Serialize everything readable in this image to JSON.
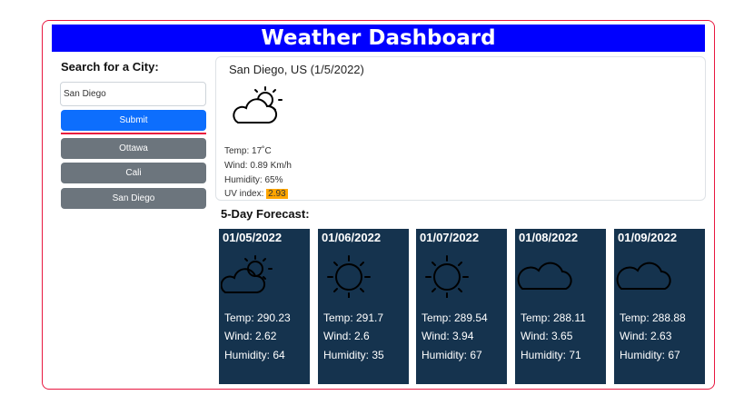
{
  "header": {
    "title": "Weather Dashboard"
  },
  "sidebar": {
    "search_title": "Search for a City:",
    "search_value": "San Diego",
    "submit_label": "Submit",
    "history": [
      "Ottawa",
      "Cali",
      "San Diego"
    ]
  },
  "current": {
    "title": "San Diego, US (1/5/2022)",
    "icon": "partly-cloudy-icon",
    "temp": "Temp: 17˚C",
    "wind": "Wind: 0.89 Km/h",
    "humidity": "Humidity: 65%",
    "uv_label": "UV index: ",
    "uv_value": "2.93",
    "uv_color": "#ffa500"
  },
  "forecast_title": "5-Day Forecast:",
  "forecast": [
    {
      "date": "01/05/2022",
      "icon": "partly-cloudy-icon",
      "temp": "Temp: 290.23",
      "wind": "Wind: 2.62",
      "humidity": "Humidity: 64"
    },
    {
      "date": "01/06/2022",
      "icon": "sun-icon",
      "temp": "Temp: 291.7",
      "wind": "Wind: 2.6",
      "humidity": "Humidity: 35"
    },
    {
      "date": "01/07/2022",
      "icon": "sun-icon",
      "temp": "Temp: 289.54",
      "wind": "Wind: 3.94",
      "humidity": "Humidity: 67"
    },
    {
      "date": "01/08/2022",
      "icon": "cloud-icon",
      "temp": "Temp: 288.11",
      "wind": "Wind: 3.65",
      "humidity": "Humidity: 71"
    },
    {
      "date": "01/09/2022",
      "icon": "cloud-icon",
      "temp": "Temp: 288.88",
      "wind": "Wind: 2.63",
      "humidity": "Humidity: 67"
    }
  ],
  "colors": {
    "header_bg": "#0000ff",
    "frame_border": "#e8173f",
    "submit_bg": "#0d6efd",
    "history_bg": "#6c757d",
    "forecast_bg": "#15334e"
  }
}
